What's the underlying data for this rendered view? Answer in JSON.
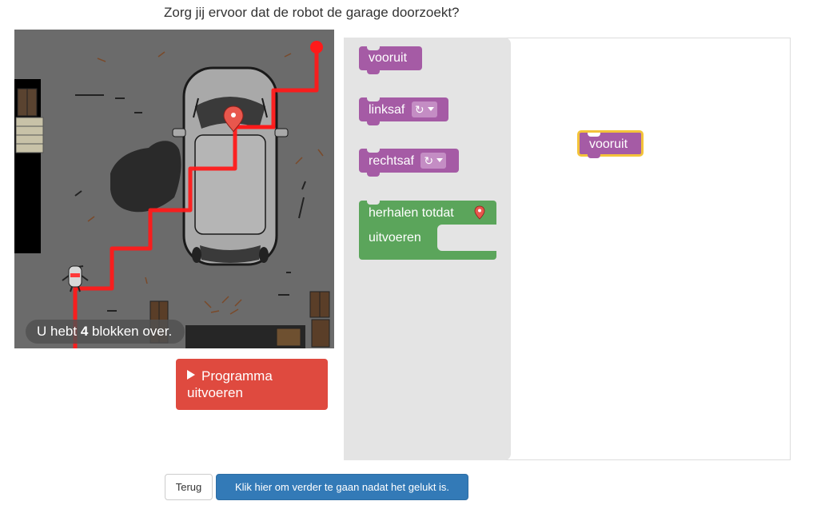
{
  "question": "Zorg jij ervoor dat de robot de garage doorzoekt?",
  "game": {
    "remaining_prefix": "U hebt",
    "remaining_count": "4",
    "remaining_suffix": "blokken over."
  },
  "run_button": {
    "icon": "play-icon",
    "label": "Programma uitvoeren"
  },
  "toolbox": {
    "blocks": {
      "forward": "vooruit",
      "left": "linksaf",
      "left_icon": "↻",
      "right": "rechtsaf",
      "right_icon": "↻",
      "repeat_until": "herhalen totdat",
      "repeat_until_icon": "map-marker-icon",
      "do": "uitvoeren"
    }
  },
  "workspace": {
    "blocks": {
      "forward": "vooruit"
    }
  },
  "footer": {
    "back_label": "Terug",
    "next_label": "Klik hier om verder te gaan nadat het gelukt is."
  },
  "colors": {
    "motion_block": "#a55ba5",
    "loop_block": "#5ba55b",
    "run_button": "#df4a3f",
    "next_button": "#337ab7",
    "path": "#ff1a1a",
    "selected_outline": "#f3c33a"
  }
}
